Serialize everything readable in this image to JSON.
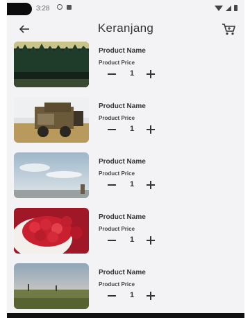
{
  "status_bar": {
    "time": "3:28"
  },
  "app_bar": {
    "title": "Keranjang"
  },
  "cart": {
    "items": [
      {
        "name": "Product Name",
        "price": "Product Price",
        "quantity": "1",
        "image": "forest-photo"
      },
      {
        "name": "Product Name",
        "price": "Product Price",
        "quantity": "1",
        "image": "old-truck-photo"
      },
      {
        "name": "Product Name",
        "price": "Product Price",
        "quantity": "1",
        "image": "sky-field-photo"
      },
      {
        "name": "Product Name",
        "price": "Product Price",
        "quantity": "1",
        "image": "raspberries-photo"
      },
      {
        "name": "Product Name",
        "price": "Product Price",
        "quantity": "1",
        "image": "meadow-photo"
      }
    ]
  },
  "icons": {
    "back": "arrow-left-icon",
    "cart": "shopping-cart-icon",
    "minus": "minus-icon",
    "plus": "plus-icon"
  },
  "colors": {
    "background": "#f3f3f5",
    "text": "#333333"
  }
}
